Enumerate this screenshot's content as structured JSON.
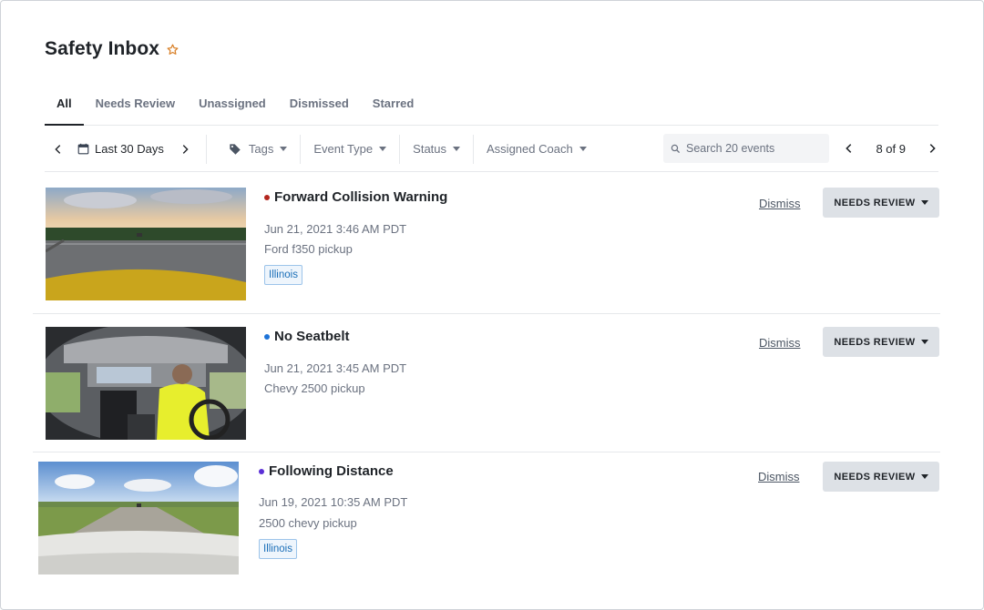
{
  "page": {
    "title": "Safety Inbox"
  },
  "tabs": [
    {
      "label": "All",
      "active": true
    },
    {
      "label": "Needs Review"
    },
    {
      "label": "Unassigned"
    },
    {
      "label": "Dismissed"
    },
    {
      "label": "Starred"
    }
  ],
  "filters": {
    "date_range": "Last 30 Days",
    "tags": "Tags",
    "event_type": "Event Type",
    "status": "Status",
    "assigned_coach": "Assigned Coach"
  },
  "search": {
    "placeholder": "Search 20 events"
  },
  "pagination": {
    "label": "8 of 9"
  },
  "events": [
    {
      "title": "Forward Collision Warning",
      "dot_color": "#b3261e",
      "timestamp": "Jun 21, 2021 3:46 AM PDT",
      "vehicle": "Ford f350 pickup",
      "tag": "Illinois",
      "dismiss": "Dismiss",
      "status": "NEEDS REVIEW"
    },
    {
      "title": "No Seatbelt",
      "dot_color": "#1d73d8",
      "timestamp": "Jun 21, 2021 3:45 AM PDT",
      "vehicle": "Chevy 2500 pickup",
      "dismiss": "Dismiss",
      "status": "NEEDS REVIEW"
    },
    {
      "title": "Following Distance",
      "dot_color": "#5b2fd6",
      "timestamp": "Jun 19, 2021 10:35 AM PDT",
      "vehicle": "2500 chevy pickup",
      "tag": "Illinois",
      "dismiss": "Dismiss",
      "status": "NEEDS REVIEW"
    }
  ],
  "colors": {
    "star": "#d9822b",
    "tag_text": "#1b6fb8",
    "status_bg": "#dde1e6"
  }
}
